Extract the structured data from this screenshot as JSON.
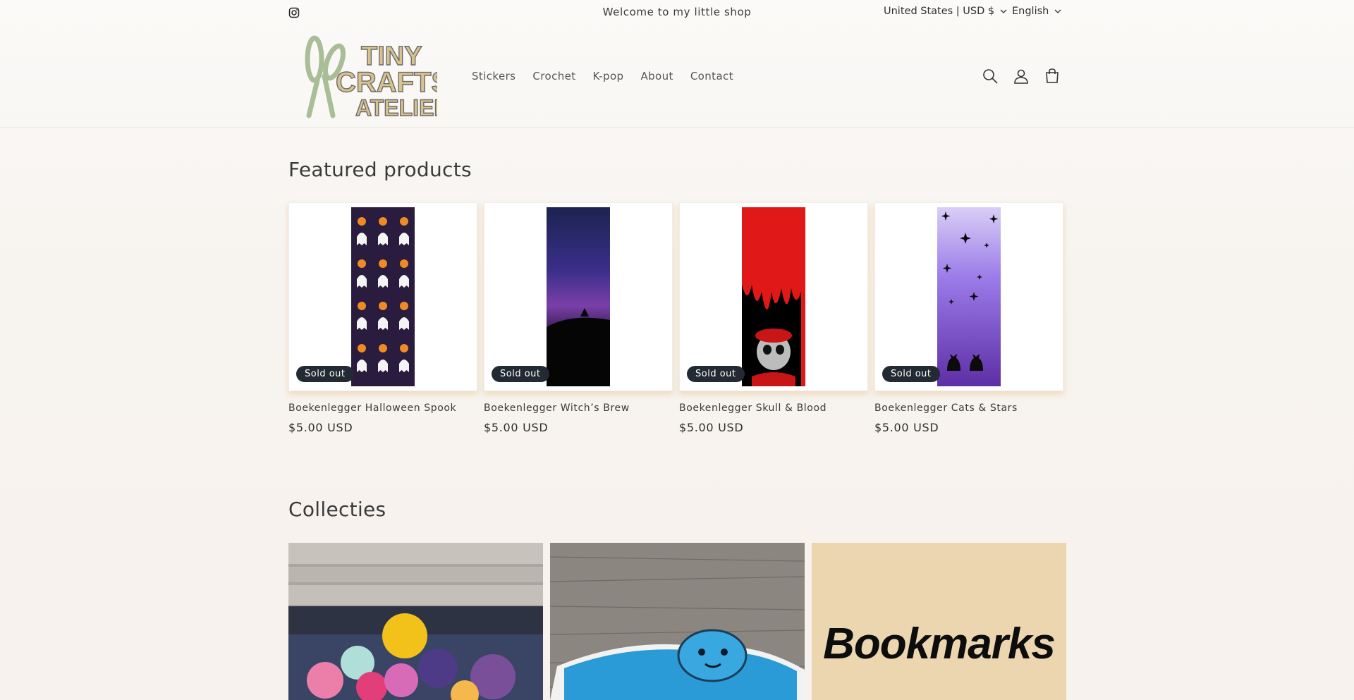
{
  "announcement": {
    "text": "Welcome to my little shop",
    "country_selector": "United States | USD $",
    "language_selector": "English"
  },
  "header": {
    "logo_text": [
      "TINY",
      "CRAFTS",
      "ATELIER"
    ],
    "nav": [
      "Stickers",
      "Crochet",
      "K-pop",
      "About",
      "Contact"
    ],
    "icons": [
      "search-icon",
      "account-icon",
      "cart-icon"
    ]
  },
  "featured": {
    "title": "Featured products",
    "products": [
      {
        "title": "Boekenlegger Halloween Spook",
        "price": "$5.00 USD",
        "badge": "Sold out"
      },
      {
        "title": "Boekenlegger Witch’s Brew",
        "price": "$5.00 USD",
        "badge": "Sold out"
      },
      {
        "title": "Boekenlegger Skull & Blood",
        "price": "$5.00 USD",
        "badge": "Sold out"
      },
      {
        "title": "Boekenlegger Cats & Stars",
        "price": "$5.00 USD",
        "badge": "Sold out"
      }
    ]
  },
  "collections": {
    "title": "Collecties",
    "items": [
      {
        "label": ""
      },
      {
        "label": ""
      },
      {
        "label": "Bookmarks"
      }
    ]
  },
  "colors": {
    "badge_bg": "#232a33",
    "logo_green": "#a9bd97",
    "logo_tan": "#d8c38f",
    "bookmarks_bg": "#ecd6b0"
  }
}
